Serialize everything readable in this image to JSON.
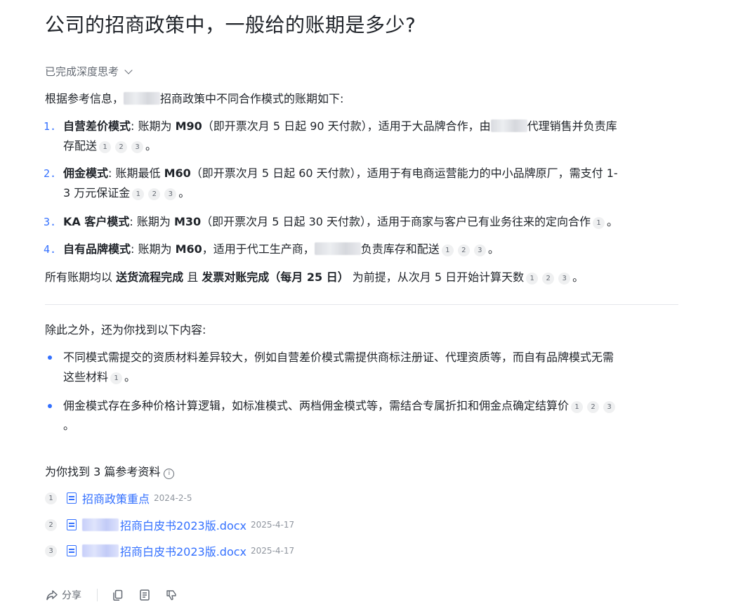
{
  "question": "公司的招商政策中，一般给的账期是多少?",
  "thinking": {
    "label": "已完成深度思考"
  },
  "intro": {
    "pre": "根据参考信息，",
    "post": "招商政策中不同合作模式的账期如下:"
  },
  "items": [
    {
      "num": "1.",
      "title": "自营差价模式",
      "t1": ": 账期为 ",
      "code": "M90",
      "t2": "（即开票次月 5 日起 90 天付款），适用于大品牌合作，由",
      "t3": "代理销售并负责库",
      "line2": "存配送",
      "cites": [
        "1",
        "2",
        "3"
      ],
      "end": "。"
    },
    {
      "num": "2.",
      "title": "佣金模式",
      "t1": ": 账期最低 ",
      "code": "M60",
      "t2": "（即开票次月 5 日起 60 天付款），适用于有电商运营能力的中小品牌原厂，需支付 1-",
      "line2": "3 万元保证金",
      "cites": [
        "1",
        "2",
        "3"
      ],
      "end": "。"
    },
    {
      "num": "3.",
      "title": "KA 客户模式",
      "t1": ": 账期为 ",
      "code": "M30",
      "t2": "（即开票次月 5 日起 30 天付款），适用于商家与客户已有业务往来的定向合作",
      "cites": [
        "1"
      ],
      "end": "。"
    },
    {
      "num": "4.",
      "title": "自有品牌模式",
      "t1": ": 账期为 ",
      "code": "M60",
      "t2": "，适用于代工生产商，",
      "t3": "负责库存和配送",
      "cites": [
        "1",
        "2",
        "3"
      ],
      "end": "。"
    }
  ],
  "summary": {
    "pre": "所有账期均以 ",
    "b1": "送货流程完成",
    "mid": " 且 ",
    "b2": "发票对账完成（每月 25 日）",
    "post": " 为前提，从次月 5 日开始计算天数",
    "cites": [
      "1",
      "2",
      "3"
    ],
    "end": "。"
  },
  "extra": {
    "heading": "除此之外，还为你找到以下内容:",
    "bullets": [
      {
        "line1": "不同模式需提交的资质材料差异较大，例如自营差价模式需提供商标注册证、代理资质等，而自有品牌模式无需",
        "line2": "这些材料",
        "cites": [
          "1"
        ],
        "end": "。"
      },
      {
        "line1": "佣金模式存在多种价格计算逻辑，如标准模式、两档佣金模式等，需结合专属折扣和佣金点确定结算价",
        "cites": [
          "1",
          "2",
          "3"
        ],
        "line2": "。"
      }
    ]
  },
  "refs": {
    "heading": "为你找到 3 篇参考资料",
    "items": [
      {
        "idx": "1",
        "title": "招商政策重点",
        "date": "2024-2-5"
      },
      {
        "idx": "2",
        "title": "招商白皮书2023版.docx",
        "date": "2025-4-17"
      },
      {
        "idx": "3",
        "title": "招商白皮书2023版.docx",
        "date": "2025-4-17"
      }
    ]
  },
  "actions": {
    "share": "分享"
  },
  "colors": {
    "accent": "#3370ff",
    "text": "#1f2329",
    "muted": "#646a73"
  }
}
